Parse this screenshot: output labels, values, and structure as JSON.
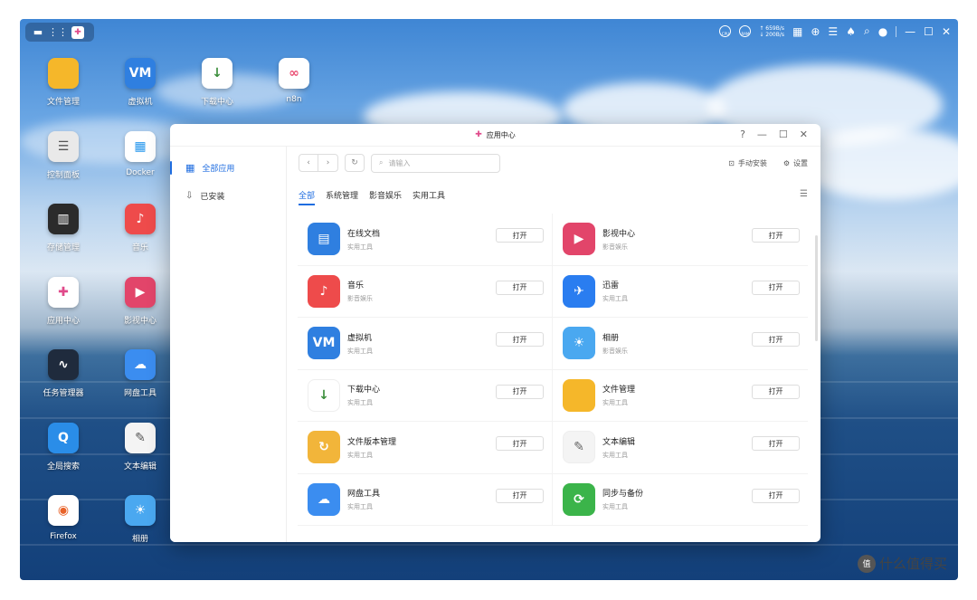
{
  "topbar": {
    "net_up": "↑ 659B/s",
    "net_down": "↓ 200B/s",
    "cpu_label": "CPU",
    "ram_label": "RAM"
  },
  "desktop": {
    "icons": [
      {
        "label": "文件管理",
        "icon": "folder-icon",
        "color": "#f5b72a",
        "glyph": ""
      },
      {
        "label": "虚拟机",
        "icon": "vm-icon",
        "color": "#2f7fe0",
        "glyph": "VM"
      },
      {
        "label": "下载中心",
        "icon": "download-icon",
        "color": "#ffffff",
        "glyph": "↓"
      },
      {
        "label": "n8n",
        "icon": "n8n-icon",
        "color": "#ffffff",
        "glyph": "∞"
      },
      {
        "label": "控制面板",
        "icon": "control-panel-icon",
        "color": "#e9e9e9",
        "glyph": "☰"
      },
      {
        "label": "Docker",
        "icon": "docker-icon",
        "color": "#ffffff",
        "glyph": "▦"
      },
      {
        "label": "存储管理",
        "icon": "storage-icon",
        "color": "#2b2b2b",
        "glyph": "▥"
      },
      {
        "label": "音乐",
        "icon": "music-icon",
        "color": "#ee4b4b",
        "glyph": "♪"
      },
      {
        "label": "应用中心",
        "icon": "app-center-icon",
        "color": "#ffffff",
        "glyph": "✚"
      },
      {
        "label": "影视中心",
        "icon": "video-icon",
        "color": "#e2456a",
        "glyph": "▶"
      },
      {
        "label": "任务管理器",
        "icon": "task-manager-icon",
        "color": "#1f2b3d",
        "glyph": "∿"
      },
      {
        "label": "网盘工具",
        "icon": "cloud-drive-icon",
        "color": "#3b8df0",
        "glyph": "☁"
      },
      {
        "label": "全局搜索",
        "icon": "search-icon",
        "color": "#2a8de8",
        "glyph": "Q"
      },
      {
        "label": "文本编辑",
        "icon": "text-edit-icon",
        "color": "#f4f4f4",
        "glyph": "✎"
      },
      {
        "label": "Firefox",
        "icon": "firefox-icon",
        "color": "#ffffff",
        "glyph": "◉"
      },
      {
        "label": "相册",
        "icon": "photos-icon",
        "color": "#4aa8f0",
        "glyph": "☀"
      }
    ]
  },
  "window": {
    "title": "应用中心",
    "help": "?",
    "sidebar": [
      {
        "label": "全部应用",
        "icon": "grid-icon"
      },
      {
        "label": "已安装",
        "icon": "installed-icon"
      }
    ],
    "search_placeholder": "请输入",
    "manual_install": "手动安装",
    "settings": "设置",
    "tabs": [
      "全部",
      "系统管理",
      "影音娱乐",
      "实用工具"
    ],
    "open_label": "打开",
    "apps": [
      [
        {
          "name": "在线文档",
          "cat": "实用工具",
          "icon": "online-doc-icon",
          "color": "#2f7fe0",
          "glyph": "▤"
        },
        {
          "name": "影视中心",
          "cat": "影音娱乐",
          "icon": "video-icon",
          "color": "#e2456a",
          "glyph": "▶"
        }
      ],
      [
        {
          "name": "音乐",
          "cat": "影音娱乐",
          "icon": "music-icon",
          "color": "#ee4b4b",
          "glyph": "♪"
        },
        {
          "name": "迅雷",
          "cat": "实用工具",
          "icon": "xunlei-icon",
          "color": "#2a7df0",
          "glyph": "✈"
        }
      ],
      [
        {
          "name": "虚拟机",
          "cat": "实用工具",
          "icon": "vm-icon",
          "color": "#2f7fe0",
          "glyph": "VM"
        },
        {
          "name": "相册",
          "cat": "影音娱乐",
          "icon": "photos-icon",
          "color": "#4aa8f0",
          "glyph": "☀"
        }
      ],
      [
        {
          "name": "下载中心",
          "cat": "实用工具",
          "icon": "download-icon",
          "color": "#ffffff",
          "glyph": "↓"
        },
        {
          "name": "文件管理",
          "cat": "实用工具",
          "icon": "folder-icon",
          "color": "#f5b72a",
          "glyph": ""
        }
      ],
      [
        {
          "name": "文件版本管理",
          "cat": "实用工具",
          "icon": "file-version-icon",
          "color": "#f2b53a",
          "glyph": "↻"
        },
        {
          "name": "文本编辑",
          "cat": "实用工具",
          "icon": "text-edit-icon",
          "color": "#f4f4f4",
          "glyph": "✎"
        }
      ],
      [
        {
          "name": "网盘工具",
          "cat": "实用工具",
          "icon": "cloud-drive-icon",
          "color": "#3b8df0",
          "glyph": "☁"
        },
        {
          "name": "同步与备份",
          "cat": "实用工具",
          "icon": "sync-icon",
          "color": "#3bb44a",
          "glyph": "⟳"
        }
      ]
    ]
  },
  "watermark": "什么值得买",
  "watermark_logo": "值"
}
